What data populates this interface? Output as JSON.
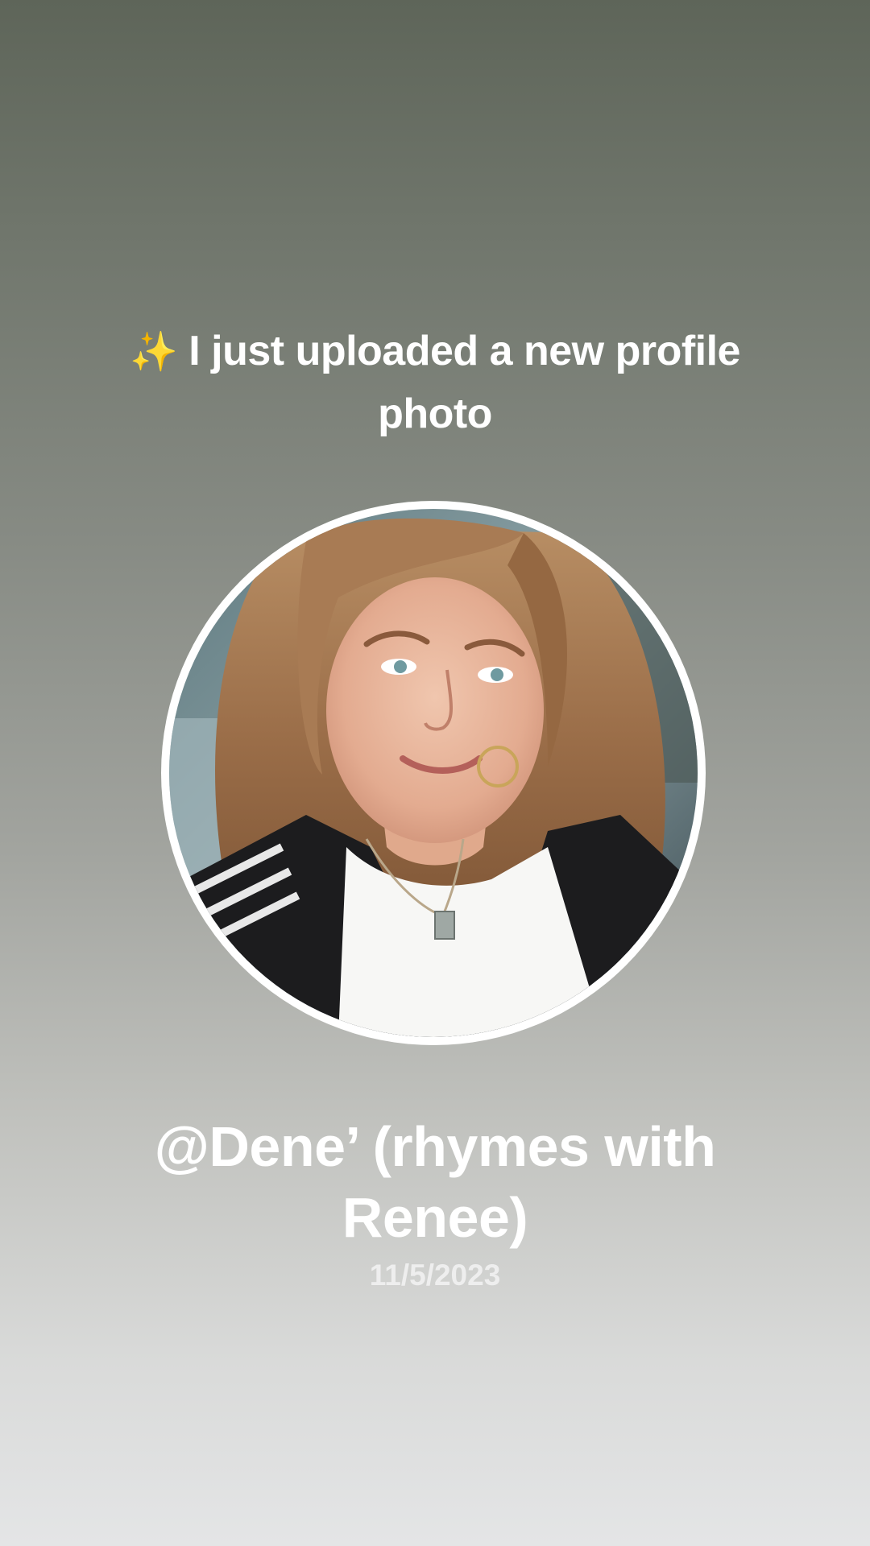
{
  "post": {
    "sparkles_icon": "sparkles-icon",
    "headline": "I just uploaded a new profile photo",
    "username": "@Dene’ (rhymes with Renee)",
    "date": "11/5/2023"
  },
  "colors": {
    "background_top": "#5e6559",
    "background_bottom": "#e4e5e6",
    "text": "#ffffff",
    "avatar_ring": "#ffffff"
  }
}
